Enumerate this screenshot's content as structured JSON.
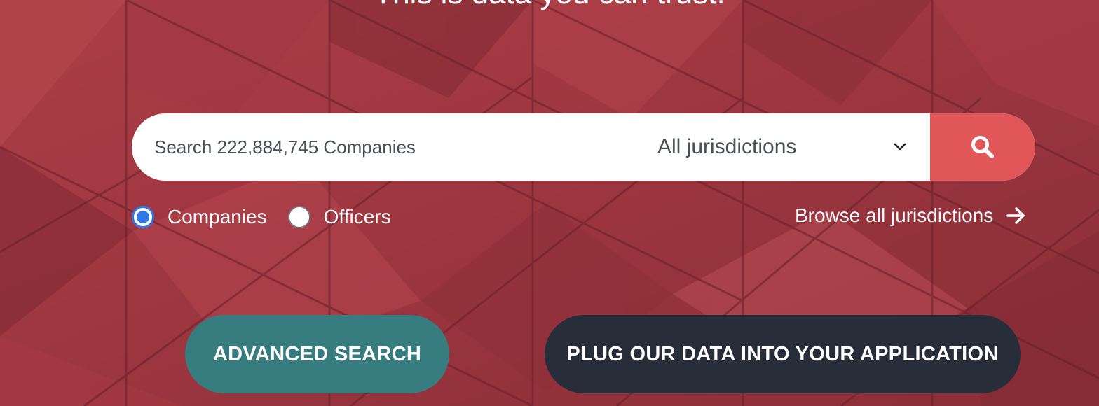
{
  "hero": {
    "tagline": "This is data you can trust."
  },
  "search": {
    "placeholder": "Search 222,884,745 Companies",
    "value": "",
    "jurisdiction_selected": "All jurisdictions",
    "search_icon": "search-icon"
  },
  "search_type": {
    "options": [
      {
        "label": "Companies",
        "checked": true
      },
      {
        "label": "Officers",
        "checked": false
      }
    ]
  },
  "browse": {
    "label": "Browse all jurisdictions",
    "icon": "arrow-right-icon"
  },
  "actions": {
    "advanced_search_label": "ADVANCED SEARCH",
    "api_label": "PLUG OUR DATA INTO YOUR APPLICATION"
  },
  "colors": {
    "hero_background": "#9d3a44",
    "search_button": "#e15659",
    "advanced_button": "#377c7f",
    "api_button": "#272d39",
    "radio_accent": "#2f78e8"
  }
}
